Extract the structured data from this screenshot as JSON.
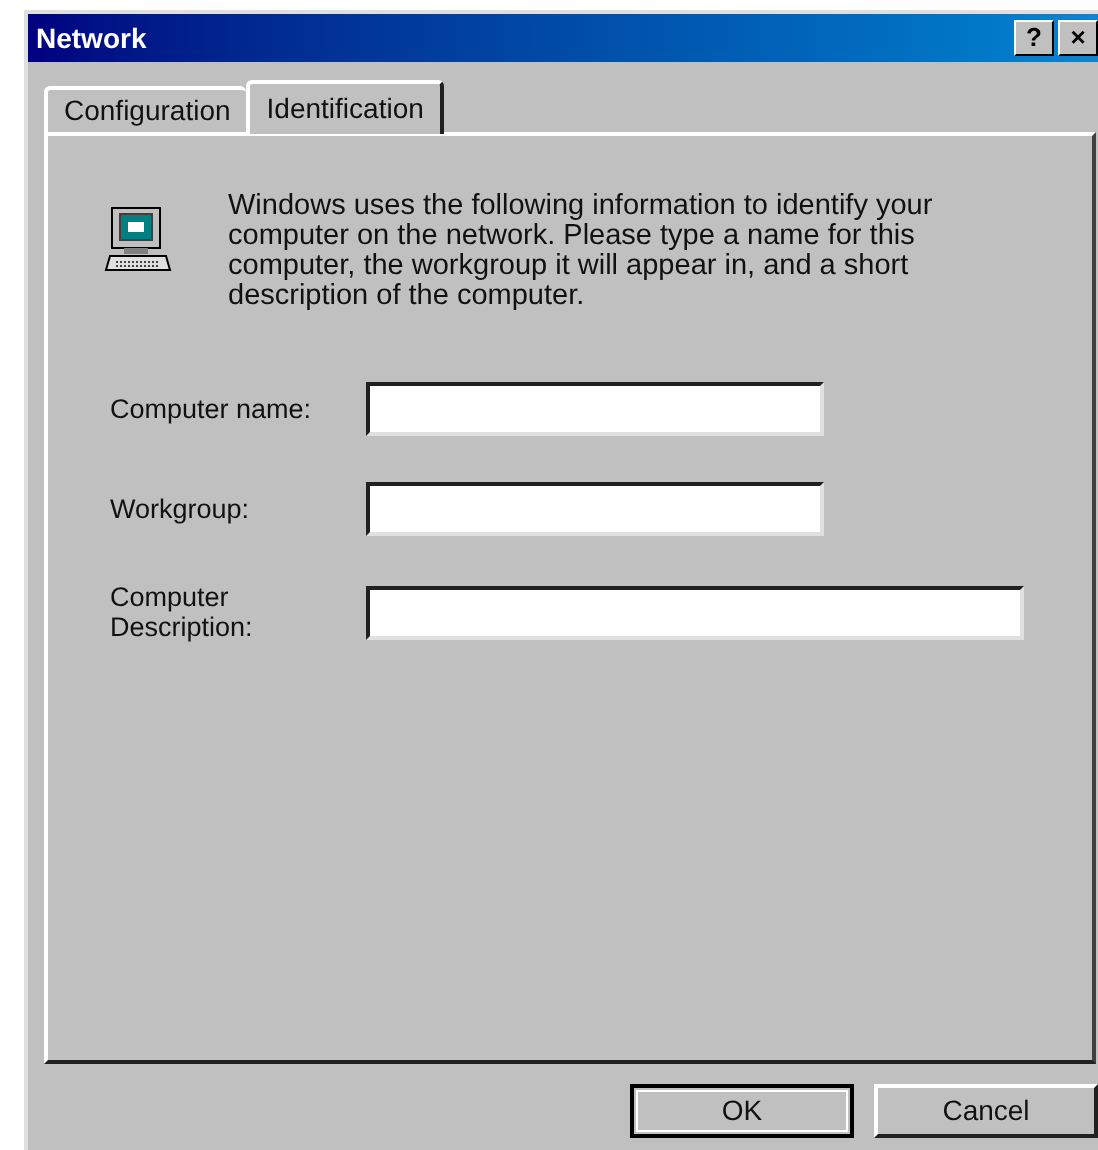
{
  "window": {
    "title": "Network",
    "title_buttons": [
      "?",
      "×"
    ]
  },
  "tabs": [
    {
      "label": "Configuration",
      "selected": false
    },
    {
      "label": "Identification",
      "selected": true
    }
  ],
  "description": "Windows uses the following information to identify your computer on the network.  Please type a name for this computer, the workgroup it will appear in, and a short description of the computer.",
  "fields": [
    {
      "label": "Computer name:",
      "wide": false
    },
    {
      "label": "Workgroup:",
      "wide": false
    },
    {
      "label": "Computer Description:",
      "wide": true
    }
  ],
  "buttons": [
    "OK",
    "Cancel"
  ]
}
